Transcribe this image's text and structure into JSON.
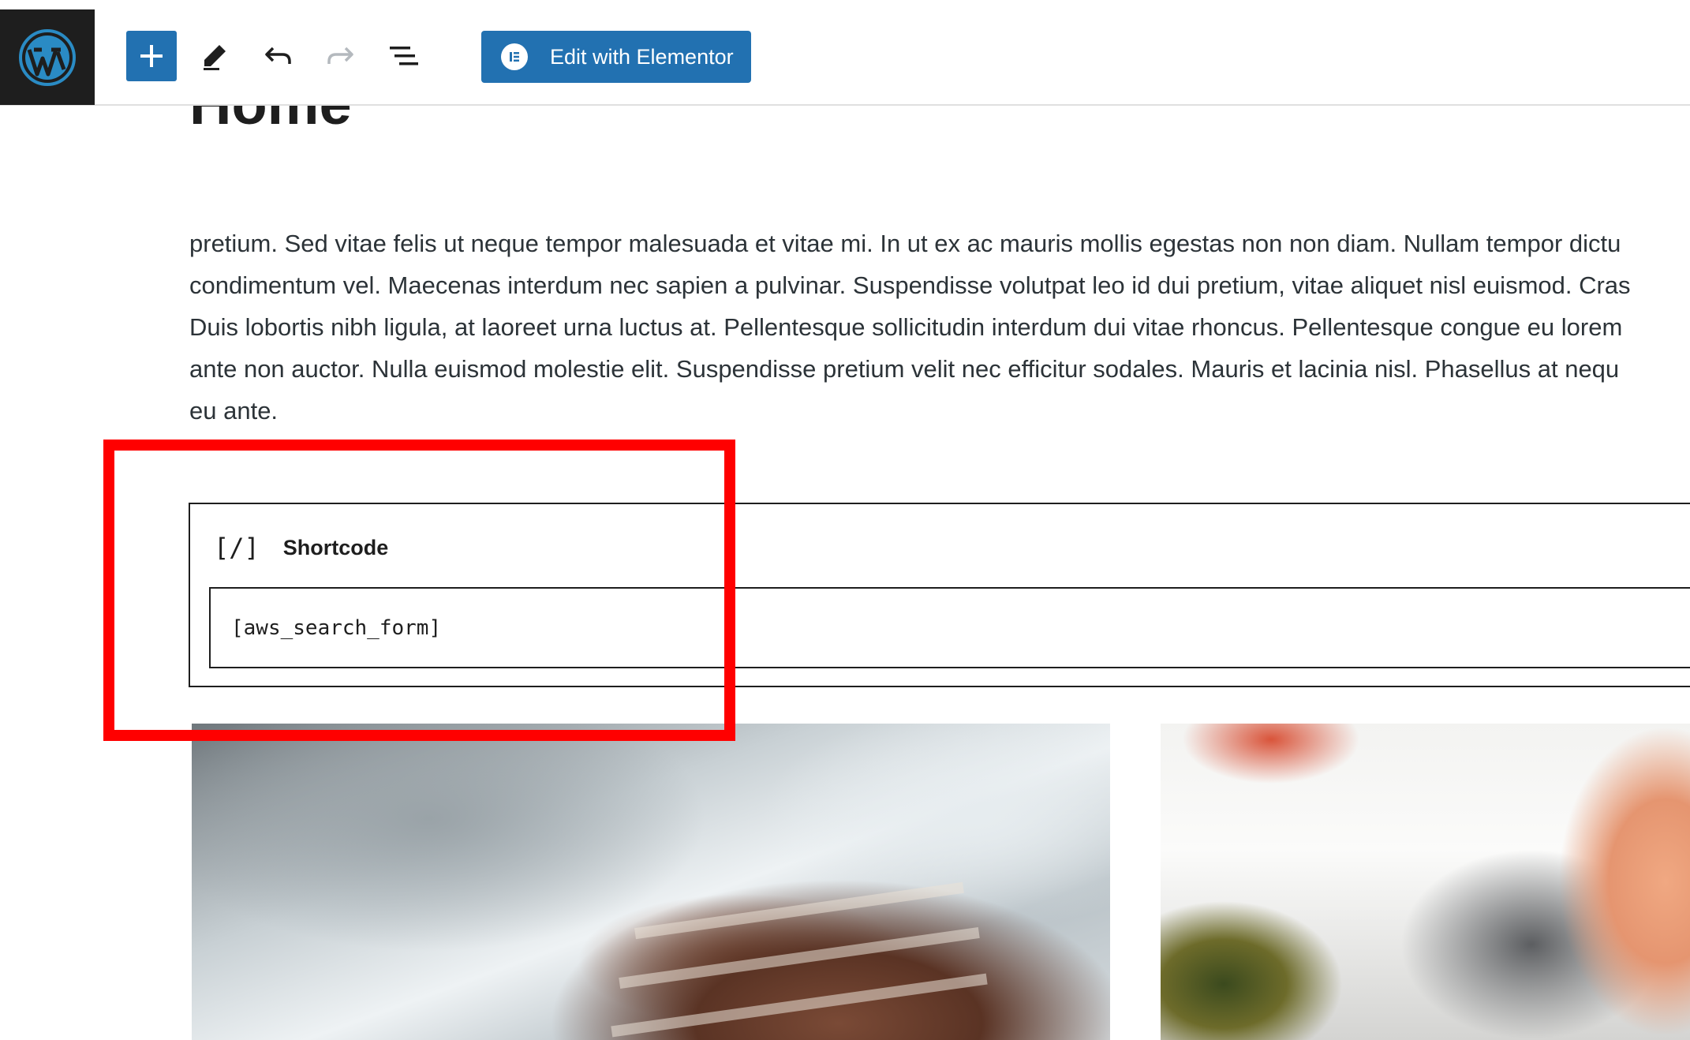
{
  "toolbar": {
    "add_label": "+",
    "edit_with_elementor": "Edit with Elementor"
  },
  "page": {
    "title": "Home"
  },
  "content": {
    "paragraph_lines": [
      "pretium. Sed vitae felis ut neque tempor malesuada et vitae mi. In ut ex ac mauris mollis egestas non non diam. Nullam tempor dictu",
      "condimentum vel. Maecenas interdum nec sapien a pulvinar. Suspendisse volutpat leo id dui pretium, vitae aliquet nisl euismod. Cras",
      "Duis lobortis nibh ligula, at laoreet urna luctus at. Pellentesque sollicitudin interdum dui vitae rhoncus. Pellentesque congue eu lorem",
      "ante non auctor. Nulla euismod molestie elit. Suspendisse pretium velit nec efficitur sodales. Mauris et lacinia nisl. Phasellus at nequ",
      "eu ante."
    ]
  },
  "shortcode_block": {
    "icon_text": "[/]",
    "label": "Shortcode",
    "value": "[aws_search_form]"
  },
  "colors": {
    "accent": "#2271b1",
    "highlight": "#ff0000",
    "sidebar_dark": "#1e1e1e"
  },
  "icons": [
    "wordpress-logo-icon",
    "plus-icon",
    "pencil-icon",
    "undo-icon",
    "redo-icon",
    "document-overview-icon",
    "elementor-icon"
  ]
}
